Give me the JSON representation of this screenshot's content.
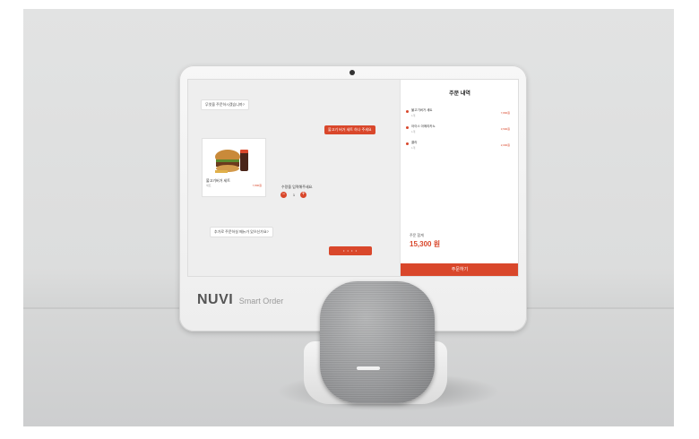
{
  "colors": {
    "accent": "#d9472b",
    "chat_bg": "#eeeeee",
    "panel_bg": "#ffffff"
  },
  "brand": {
    "name": "NUVI",
    "sub": "Smart Order"
  },
  "chat": {
    "bubble1": "무엇을 주문하시겠습니까?",
    "bubble2": "불고기 버거 세트 하나 주세요",
    "product": {
      "name": "불고기버거 세트",
      "sub": "세트",
      "price": "7,800원",
      "icon": "burger-image"
    },
    "qty_label": "수량을 입력해주세요.",
    "qty_value": "1",
    "qty_minus": "−",
    "qty_plus": "+",
    "bubble3": "추가로 주문하실 메뉴가 있으신가요?",
    "input_dots": "• • • •"
  },
  "order": {
    "title": "주문 내역",
    "items": [
      {
        "name": "불고기버거 세트",
        "sub": "1개",
        "price": "7,800원"
      },
      {
        "name": "아이스 아메리카노",
        "sub": "1개",
        "price": "3,500원"
      },
      {
        "name": "콜라",
        "sub": "1개",
        "price": "2,000원"
      }
    ],
    "total_label": "주문 합계",
    "total": "15,300 원",
    "button": "주문하기"
  }
}
